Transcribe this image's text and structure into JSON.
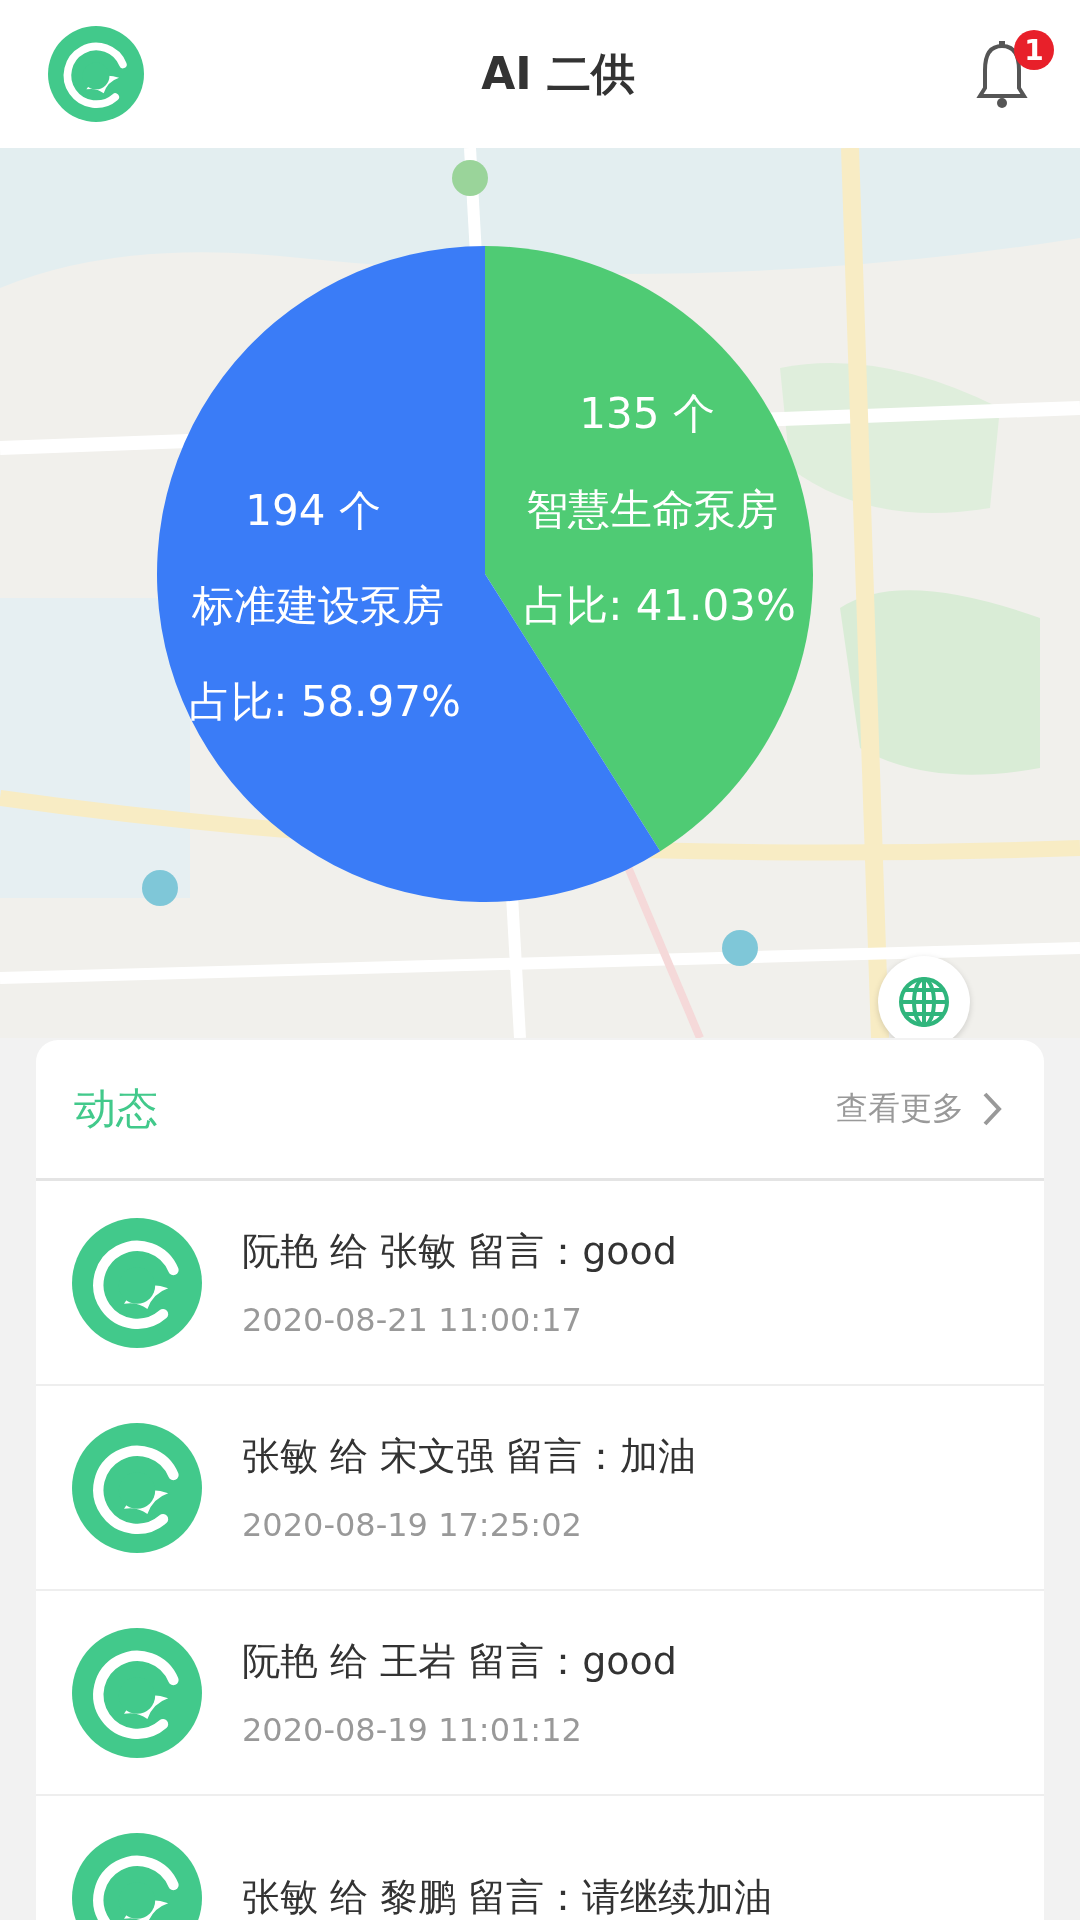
{
  "header": {
    "title": "AI 二供",
    "notification_count": "1"
  },
  "chart": {
    "chart_data": {
      "type": "pie",
      "categories": [
        "智慧生命泵房",
        "标准建设泵房"
      ],
      "values": [
        41.03,
        58.97
      ],
      "colors": [
        "#4fcb74",
        "#3a7cf7"
      ]
    },
    "slice_labels": [
      {
        "count": "135 个",
        "share": "占比: 41.03%"
      },
      {
        "count": "194 个",
        "share": "占比: 58.97%"
      }
    ]
  },
  "feed": {
    "title": "动态",
    "more": "查看更多",
    "items": [
      {
        "text": "阮艳 给 张敏 留言：good",
        "time": "2020-08-21 11:00:17"
      },
      {
        "text": "张敏 给 宋文强 留言：加油",
        "time": "2020-08-19 17:25:02"
      },
      {
        "text": "阮艳 给 王岩 留言：good",
        "time": "2020-08-19 11:01:12"
      },
      {
        "text": "张敏 给 黎鹏 留言：请继续加油"
      }
    ]
  }
}
